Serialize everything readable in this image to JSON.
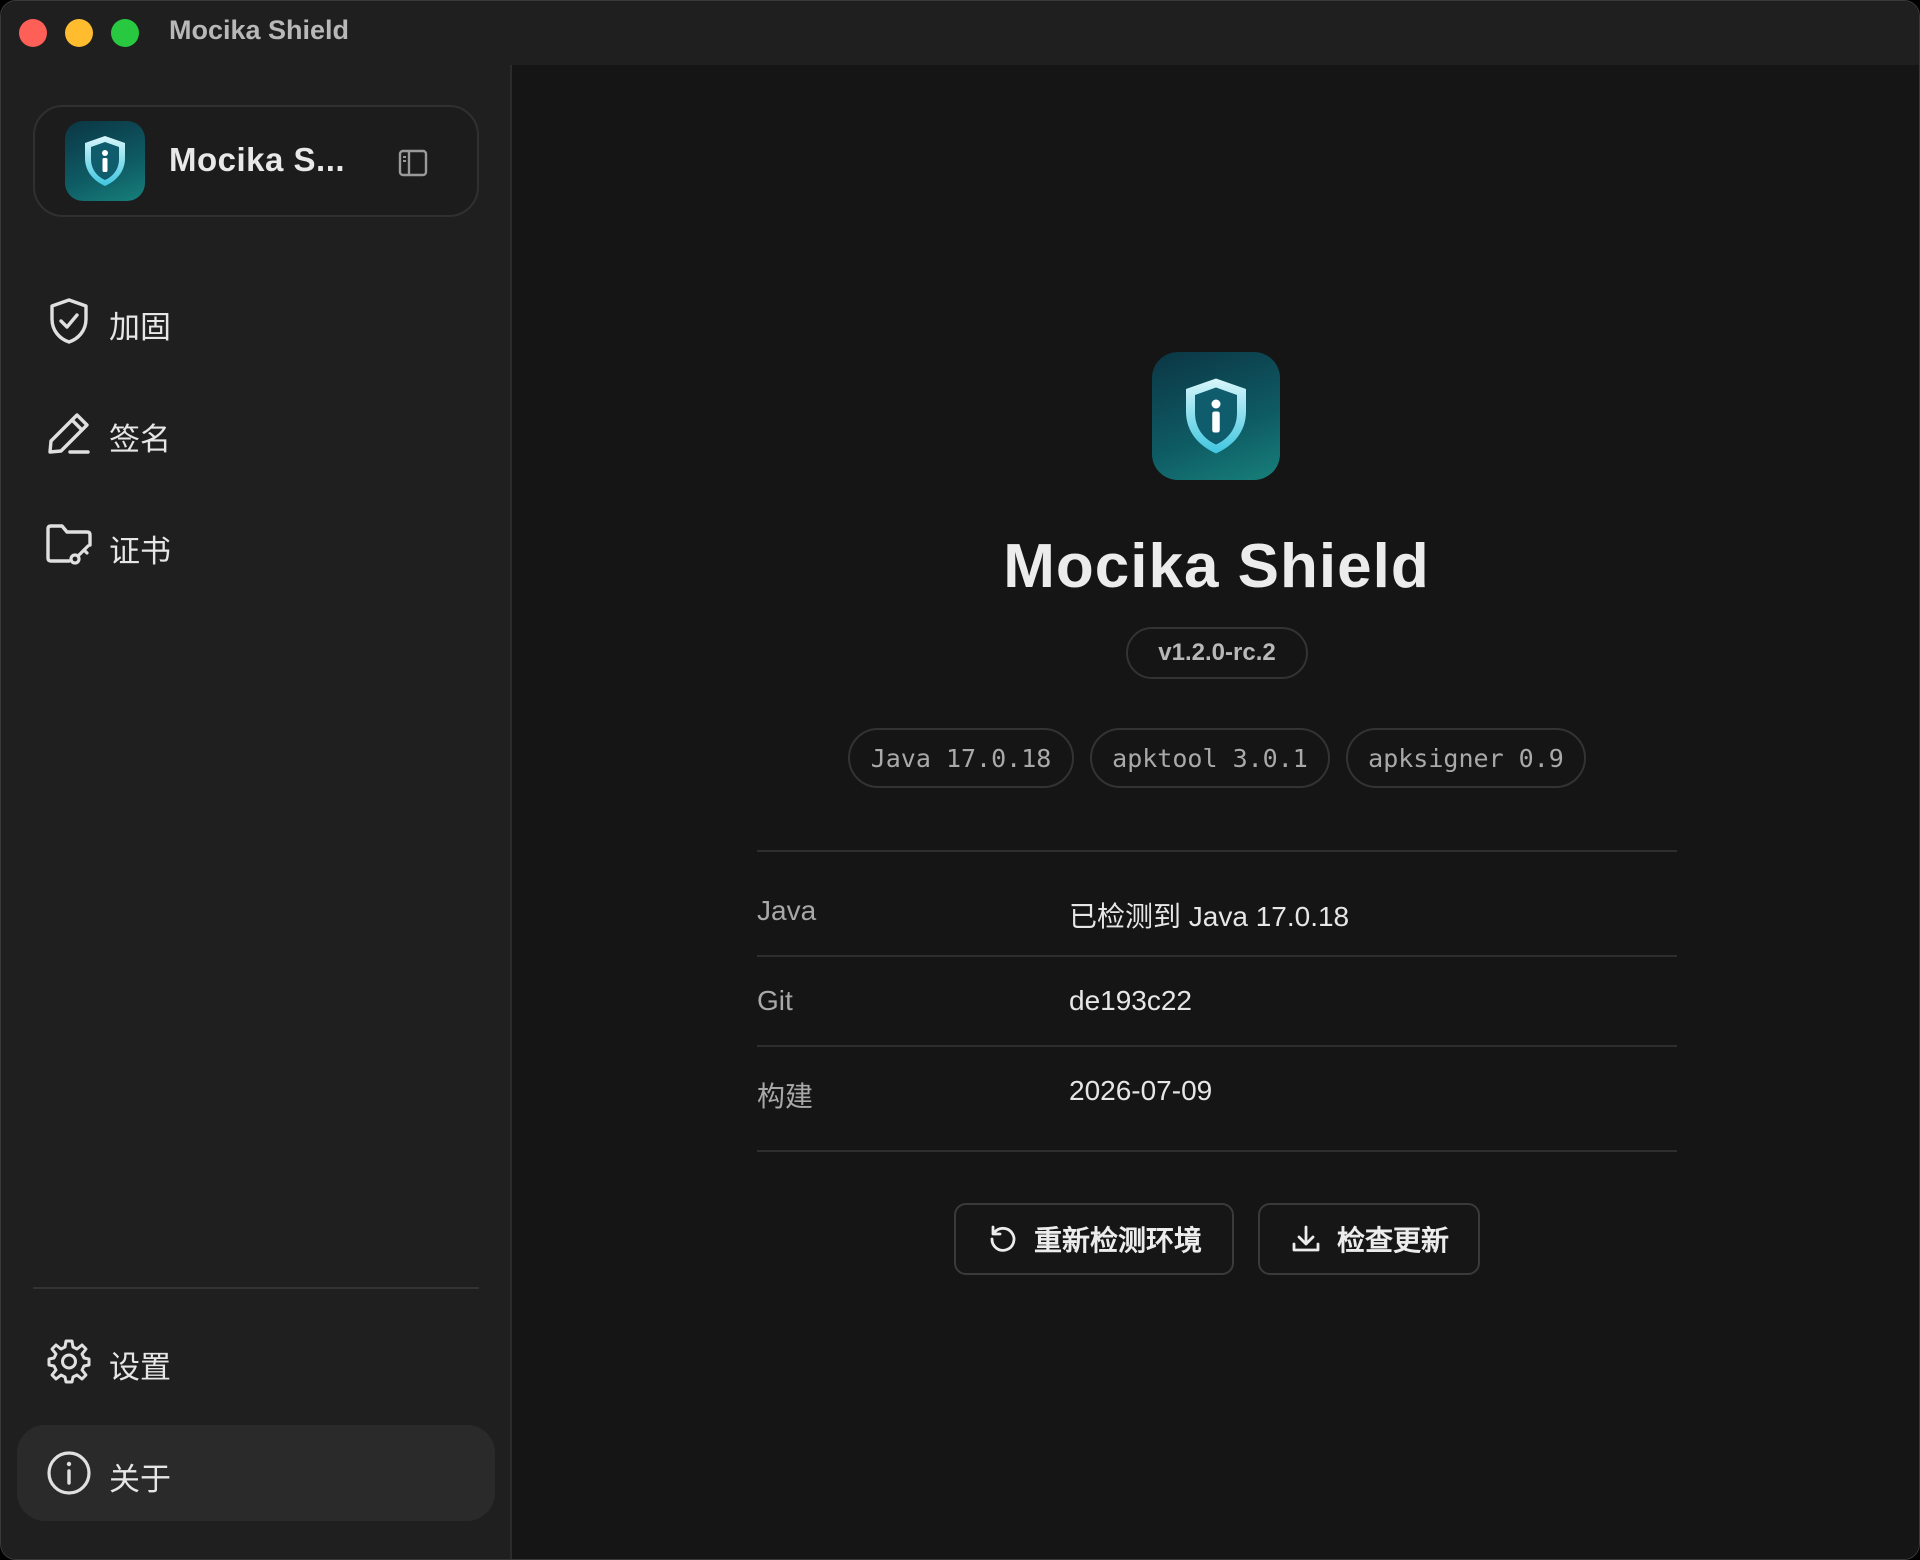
{
  "window": {
    "title": "Mocika Shield"
  },
  "sidebar": {
    "app_name": "Mocika S...",
    "items": [
      {
        "label": "加固",
        "icon": "shield-check-icon"
      },
      {
        "label": "签名",
        "icon": "pen-icon"
      },
      {
        "label": "证书",
        "icon": "folder-key-icon"
      }
    ],
    "bottom_items": [
      {
        "label": "设置",
        "icon": "gear-icon"
      },
      {
        "label": "关于",
        "icon": "info-icon",
        "active": true
      }
    ]
  },
  "about": {
    "title": "Mocika Shield",
    "version": "v1.2.0-rc.2",
    "tool_badges": [
      "Java 17.0.18",
      "apktool 3.0.1",
      "apksigner 0.9"
    ],
    "info_rows": [
      {
        "label": "Java",
        "value": "已检测到 Java 17.0.18"
      },
      {
        "label": "Git",
        "value": "de193c22"
      },
      {
        "label": "构建",
        "value": "2026-07-09"
      }
    ],
    "buttons": {
      "recheck": "重新检测环境",
      "check_update": "检查更新"
    }
  },
  "colors": {
    "background": "#151515",
    "sidebar": "#1f1f1f",
    "icon_gradient_start": "#0b3644",
    "icon_gradient_end": "#17807a",
    "shield_light": "#7fe3f2"
  }
}
